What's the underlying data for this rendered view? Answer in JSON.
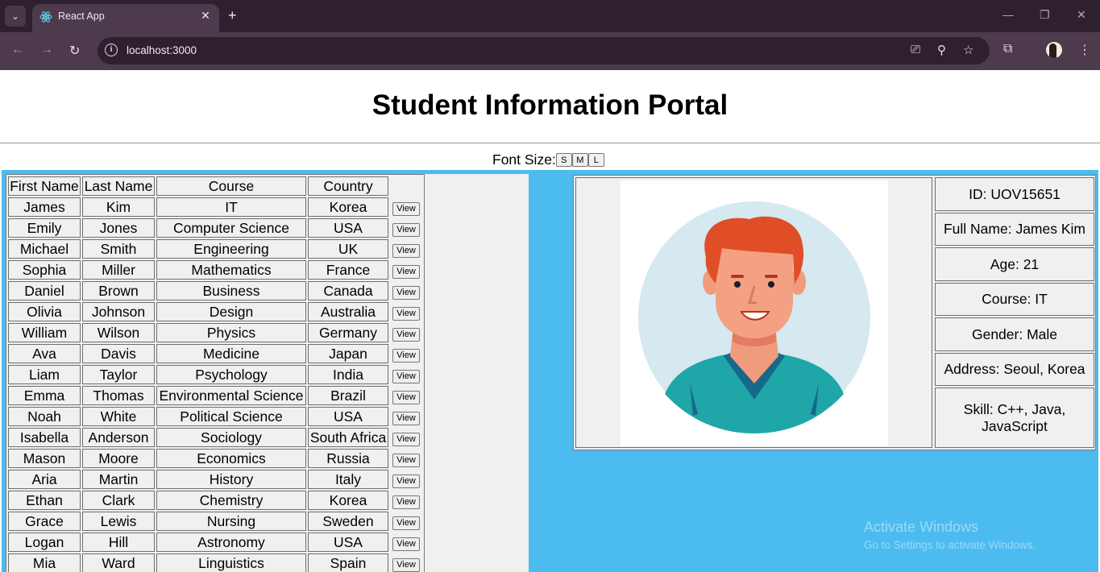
{
  "browser": {
    "tab_title": "React App",
    "url": "localhost:3000"
  },
  "page": {
    "title": "Student Information Portal",
    "font_size_label": "Font Size:",
    "font_buttons": [
      "S",
      "M",
      "L"
    ]
  },
  "table": {
    "headers": [
      "First Name",
      "Last Name",
      "Course",
      "Country"
    ],
    "view_label": "View",
    "rows": [
      [
        "James",
        "Kim",
        "IT",
        "Korea"
      ],
      [
        "Emily",
        "Jones",
        "Computer Science",
        "USA"
      ],
      [
        "Michael",
        "Smith",
        "Engineering",
        "UK"
      ],
      [
        "Sophia",
        "Miller",
        "Mathematics",
        "France"
      ],
      [
        "Daniel",
        "Brown",
        "Business",
        "Canada"
      ],
      [
        "Olivia",
        "Johnson",
        "Design",
        "Australia"
      ],
      [
        "William",
        "Wilson",
        "Physics",
        "Germany"
      ],
      [
        "Ava",
        "Davis",
        "Medicine",
        "Japan"
      ],
      [
        "Liam",
        "Taylor",
        "Psychology",
        "India"
      ],
      [
        "Emma",
        "Thomas",
        "Environmental Science",
        "Brazil"
      ],
      [
        "Noah",
        "White",
        "Political Science",
        "USA"
      ],
      [
        "Isabella",
        "Anderson",
        "Sociology",
        "South Africa"
      ],
      [
        "Mason",
        "Moore",
        "Economics",
        "Russia"
      ],
      [
        "Aria",
        "Martin",
        "History",
        "Italy"
      ],
      [
        "Ethan",
        "Clark",
        "Chemistry",
        "Korea"
      ],
      [
        "Grace",
        "Lewis",
        "Nursing",
        "Sweden"
      ],
      [
        "Logan",
        "Hill",
        "Astronomy",
        "USA"
      ],
      [
        "Mia",
        "Ward",
        "Linguistics",
        "Spain"
      ]
    ]
  },
  "detail": {
    "id": "ID: UOV15651",
    "full_name": "Full Name: James Kim",
    "age": "Age: 21",
    "course": "Course: IT",
    "gender": "Gender: Male",
    "address": "Address: Seoul, Korea",
    "skill": "Skill: C++, Java, JavaScript"
  },
  "watermark": {
    "line1": "Activate Windows",
    "line2": "Go to Settings to activate Windows."
  },
  "colors": {
    "content_bg": "#4cbbf0",
    "panel_bg": "#f0f0f0",
    "browser_frame": "#2f2030"
  }
}
